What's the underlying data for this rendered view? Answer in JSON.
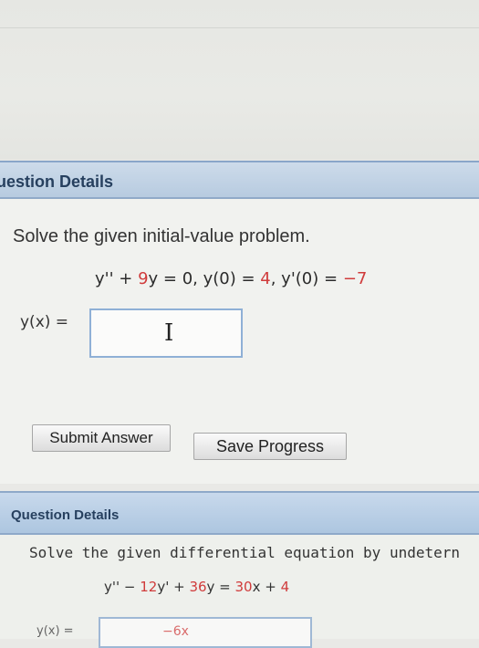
{
  "question1": {
    "header": "uestion Details",
    "prompt": "Solve the given initial-value problem.",
    "equation": {
      "lhs1": "y'' + ",
      "coef": "9",
      "lhs2": "y = 0,  y(0) = ",
      "v0": "4",
      "mid": ",  y'(0) = ",
      "v1": "−7"
    },
    "answer_label": "y(x) =",
    "cursor": "I",
    "submit_label": "Submit Answer",
    "save_label": "Save Progress"
  },
  "question2": {
    "header": "Question Details",
    "prompt": "Solve the given differential equation by undetern",
    "equation": {
      "a": "y'' − ",
      "b": "12",
      "c": "y' + ",
      "d": "36",
      "e": "y = ",
      "f": "30",
      "g": "x + ",
      "h": "4"
    },
    "answer_label": "y(x) =",
    "answer_partial": "−6x"
  },
  "colors": {
    "header_blue": "#b7cbe0",
    "accent_red": "#d03b3b",
    "input_border": "#8fb0d6"
  }
}
